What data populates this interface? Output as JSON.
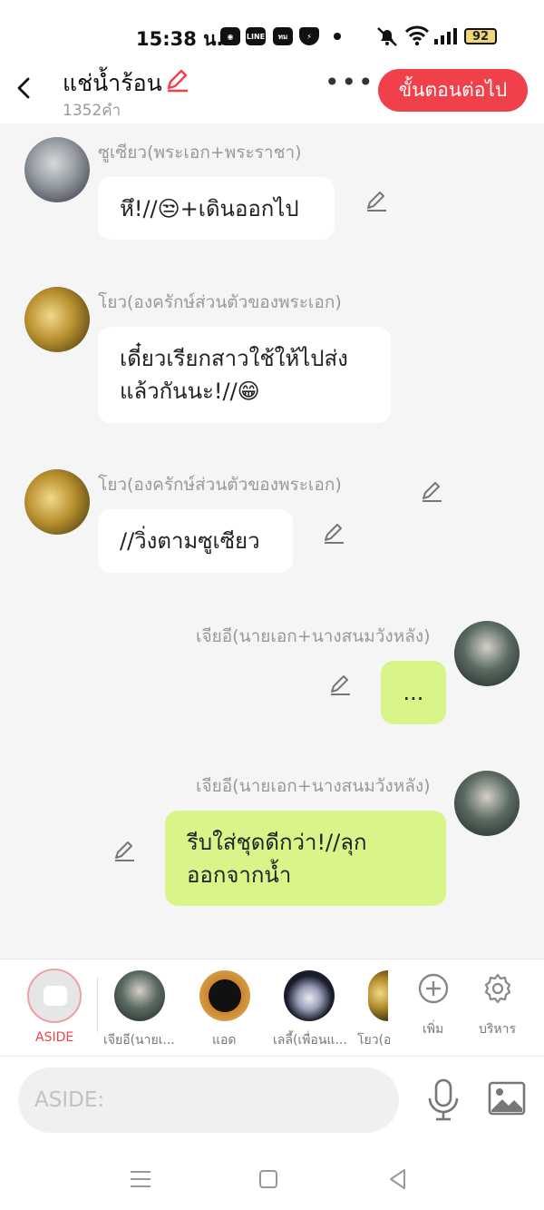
{
  "status_bar": {
    "time": "15:38 น.",
    "app_icons": [
      "camera-icon",
      "line-icon",
      "app-icon",
      "shield-icon"
    ],
    "battery": "92"
  },
  "header": {
    "title": "แช่น้ำร้อน",
    "word_count": "1352คำ",
    "next_button": "ขั้นตอนต่อไป"
  },
  "messages": [
    {
      "name": "ซูเซียว(พระเอก+พระราชา)",
      "lines": [
        "หึ!//😒+เดินออกไป"
      ],
      "side": "left",
      "color": "white"
    },
    {
      "name": "โยว(องครักษ์ส่วนตัวของพระเอก)",
      "lines": [
        "เดี๋ยวเรียกสาวใช้ให้ไปส่ง",
        "แล้วกันนะ!//😁"
      ],
      "side": "left",
      "color": "white"
    },
    {
      "name": "โยว(องครักษ์ส่วนตัวของพระเอก)",
      "lines": [
        "//วิ่งตามซูเซียว"
      ],
      "side": "left",
      "color": "white"
    },
    {
      "name": "เจียอี(นายเอก+นางสนมวังหลัง)",
      "lines": [
        "..."
      ],
      "side": "right",
      "color": "green"
    },
    {
      "name": "เจียอี(นายเอก+นางสนมวังหลัง)",
      "lines": [
        "รีบใส่ชุดดีกว่า!//ลุก",
        "ออกจากน้ำ"
      ],
      "side": "right",
      "color": "green"
    }
  ],
  "roles": {
    "aside_label": "ASIDE",
    "items": [
      "เจียอี(นายเ...",
      "แอด",
      "เลลี้(เพื่อนแ...",
      "โยว(อ"
    ],
    "add_label": "เพิ่ม",
    "manage_label": "บริหาร"
  },
  "composer": {
    "placeholder": "ASIDE:"
  },
  "colors": {
    "accent": "#f0414a",
    "bubble_green": "#d9f589",
    "background": "#f5f5f5"
  }
}
